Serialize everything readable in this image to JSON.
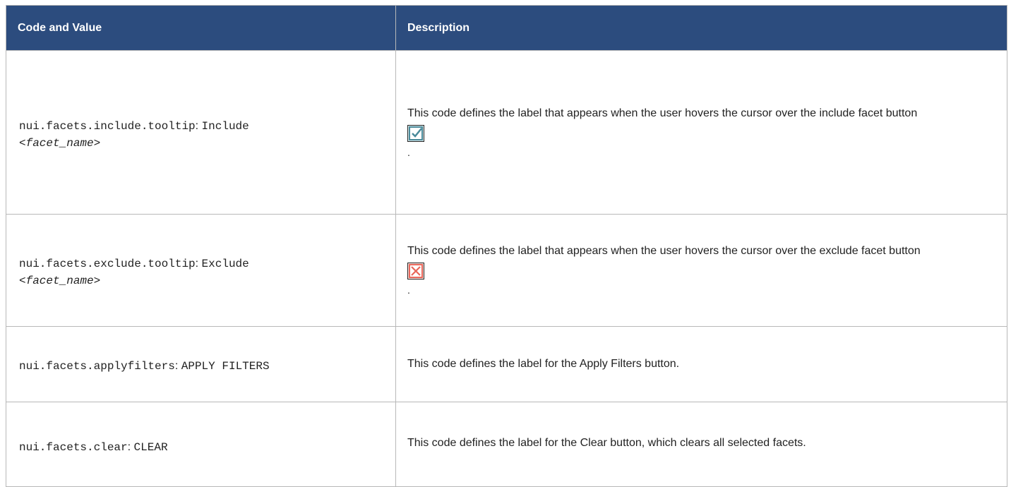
{
  "header": {
    "col_code": "Code and Value",
    "col_desc": "Description"
  },
  "rows": [
    {
      "code": "nui.facets.include.tooltip",
      "sep": ":",
      "value": "Include",
      "value_param": "<facet_name>",
      "description": "This code defines the label that appears when the user hovers the cursor over the include facet button",
      "icon": "include-checkbox-icon",
      "trailing": "."
    },
    {
      "code": "nui.facets.exclude.tooltip",
      "sep": ":",
      "value": "Exclude",
      "value_param": "<facet_name>",
      "description": "This code defines the label that appears when the user hovers the cursor over the exclude facet button",
      "icon": "exclude-checkbox-icon",
      "trailing": "."
    },
    {
      "code": "nui.facets.applyfilters",
      "sep": ":",
      "value": "APPLY FILTERS",
      "description": "This code defines the label for the Apply Filters button."
    },
    {
      "code": "nui.facets.clear",
      "sep": ":",
      "value": "CLEAR",
      "description": "This code defines the label for the Clear button, which clears all selected facets."
    }
  ],
  "colors": {
    "header_bg": "#2c4c7e",
    "header_text": "#ffffff",
    "border": "#b8b8b8",
    "include_icon": "#4a8a9a",
    "exclude_icon": "#e8665a"
  }
}
